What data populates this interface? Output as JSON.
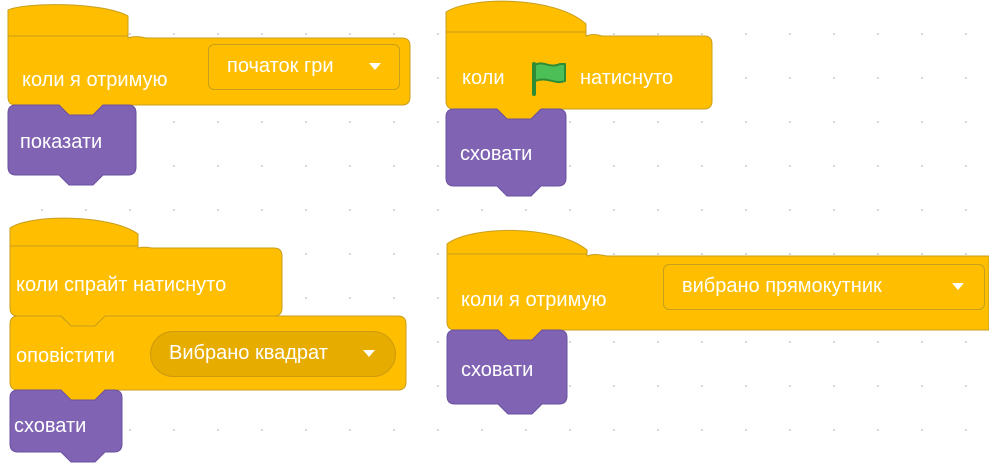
{
  "scripts": {
    "receive_start": {
      "hat_label": "коли я отримую",
      "message": "початок гри",
      "block_label": "показати"
    },
    "flag_clicked": {
      "hat_prefix": "коли",
      "hat_suffix": "натиснуто",
      "block_label": "сховати"
    },
    "sprite_clicked": {
      "hat_label": "коли спрайт натиснуто",
      "broadcast_label": "оповістити",
      "broadcast_message": "Вибрано квадрат",
      "block_label": "сховати"
    },
    "receive_rect": {
      "hat_label": "коли я отримую",
      "message": "вибрано прямокутник",
      "block_label": "сховати"
    }
  },
  "icons": {
    "flag": "green-flag-icon",
    "dropdown": "caret-down-icon"
  },
  "colors": {
    "events_block": "#ffbf00",
    "events_border": "#c79e1d",
    "looks_block": "#8064b3",
    "looks_border": "#6b50a0",
    "flag_green": "#4cbf56",
    "canvas_dots": "#d9d9d9"
  }
}
